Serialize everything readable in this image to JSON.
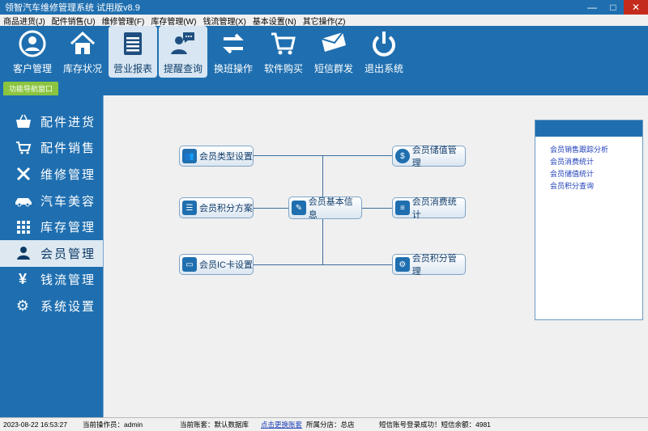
{
  "window": {
    "title": "领智汽车维修管理系统 试用版v8.9"
  },
  "menu": [
    "商品进货(J)",
    "配件销售(U)",
    "维修管理(F)",
    "库存管理(W)",
    "钱流管理(X)",
    "基本设置(N)",
    "其它操作(Z)"
  ],
  "toolbar": [
    {
      "label": "客户管理",
      "icon": "user-circle-icon"
    },
    {
      "label": "库存状况",
      "icon": "home-icon"
    },
    {
      "label": "营业报表",
      "icon": "report-icon"
    },
    {
      "label": "提醒查询",
      "icon": "chat-user-icon"
    },
    {
      "label": "换班操作",
      "icon": "swap-icon"
    },
    {
      "label": "软件购买",
      "icon": "cart-icon"
    },
    {
      "label": "短信群发",
      "icon": "mail-icon"
    },
    {
      "label": "退出系统",
      "icon": "power-icon"
    }
  ],
  "nav_tab": "功能导航窗口",
  "sidebar": [
    {
      "label": "配件进货",
      "icon": "basket-icon"
    },
    {
      "label": "配件销售",
      "icon": "cart-icon"
    },
    {
      "label": "维修管理",
      "icon": "tools-icon"
    },
    {
      "label": "汽车美容",
      "icon": "car-icon"
    },
    {
      "label": "库存管理",
      "icon": "grid-icon"
    },
    {
      "label": "会员管理",
      "icon": "user-icon"
    },
    {
      "label": "钱流管理",
      "icon": "yen-icon"
    },
    {
      "label": "系统设置",
      "icon": "gear-icon"
    }
  ],
  "diagram": {
    "center": "会员基本信息",
    "left": [
      "会员类型设置",
      "会员积分方案",
      "会员IC卡设置"
    ],
    "right": [
      "会员储值管理",
      "会员消费统计",
      "会员积分管理"
    ]
  },
  "panel": {
    "links": [
      "会员销售跟踪分析",
      "会员消费统计",
      "会员储值统计",
      "会员积分查询"
    ]
  },
  "status": {
    "datetime": "2023-08-22 16:53:27",
    "operator": "当前操作员：admin",
    "account": "当前账套：默认数据库",
    "switch_link": "点击更换账套",
    "branch": "所属分店：总店",
    "sms": "短信账号登录成功！短信余额：4981"
  }
}
